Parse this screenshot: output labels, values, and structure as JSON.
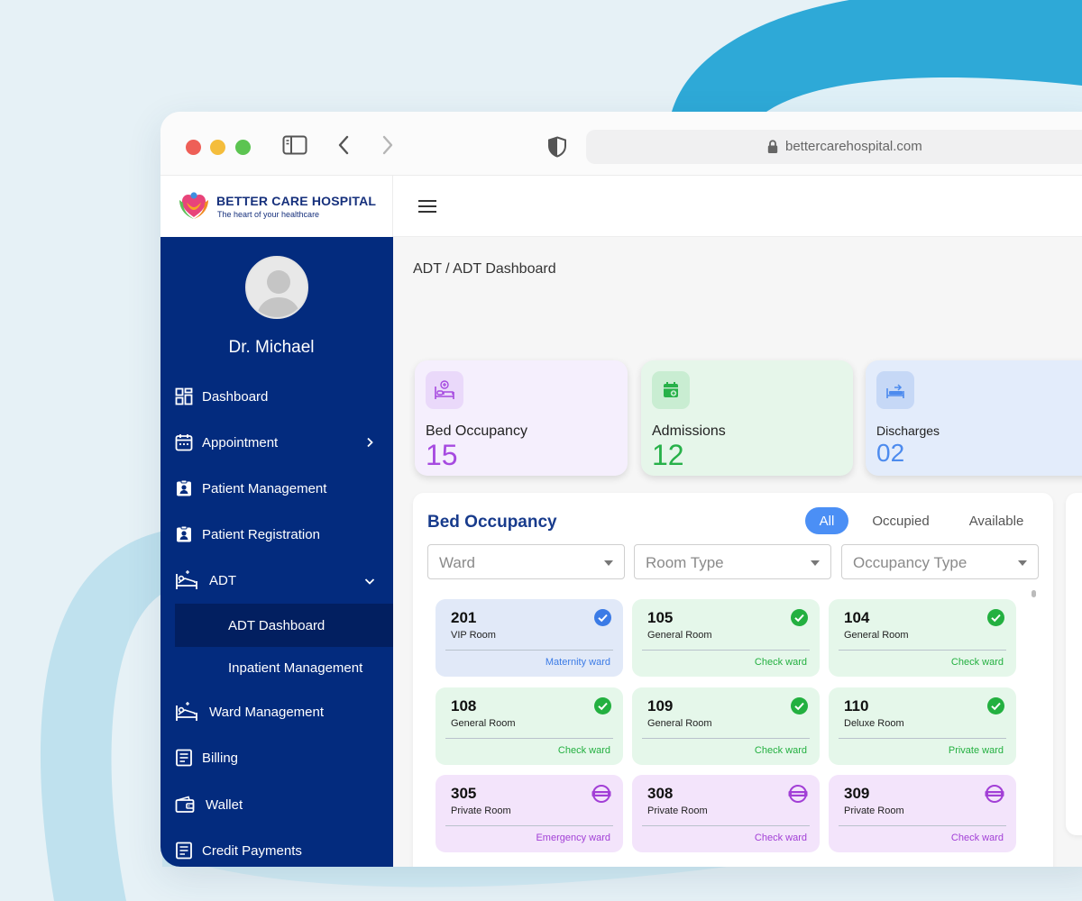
{
  "browser": {
    "url": "bettercarehospital.com"
  },
  "brand": {
    "name": "BETTER CARE HOSPITAL",
    "tagline": "The heart of your healthcare"
  },
  "user": {
    "name": "Dr. Michael"
  },
  "sidebar": {
    "items": [
      {
        "label": "Dashboard",
        "icon": "dashboard-icon"
      },
      {
        "label": "Appointment",
        "icon": "calendar-icon"
      },
      {
        "label": "Patient Management",
        "icon": "id-badge-icon"
      },
      {
        "label": "Patient Registration",
        "icon": "id-badge-icon"
      },
      {
        "label": "ADT",
        "icon": "bed-icon"
      },
      {
        "label": "ADT Dashboard"
      },
      {
        "label": "Inpatient Management"
      },
      {
        "label": "Ward Management",
        "icon": "bed-icon"
      },
      {
        "label": "Billing",
        "icon": "receipt-icon"
      },
      {
        "label": "Wallet",
        "icon": "wallet-icon"
      },
      {
        "label": "Credit Payments",
        "icon": "receipt-icon"
      }
    ]
  },
  "breadcrumb": "ADT / ADT Dashboard",
  "stats": [
    {
      "label": "Bed Occupancy",
      "value": "15",
      "color": "#a64ae0",
      "bg": "#f5effd"
    },
    {
      "label": "Admissions",
      "value": "12",
      "color": "#27b149",
      "bg": "#e6f6ea"
    },
    {
      "label": "Discharges",
      "value": "02",
      "color": "#4d8bee",
      "bg": "#e3ecfb"
    }
  ],
  "occupancy": {
    "title": "Bed Occupancy",
    "filters": [
      "All",
      "Occupied",
      "Available"
    ],
    "active_filter": "All",
    "selects": [
      "Ward",
      "Room Type",
      "Occupancy Type"
    ],
    "rooms": [
      {
        "number": "201",
        "type": "VIP Room",
        "ward": "Maternity ward",
        "status": "selected"
      },
      {
        "number": "105",
        "type": "General Room",
        "ward": "Check ward",
        "status": "available"
      },
      {
        "number": "104",
        "type": "General Room",
        "ward": "Check ward",
        "status": "available"
      },
      {
        "number": "108",
        "type": "General Room",
        "ward": "Check ward",
        "status": "available"
      },
      {
        "number": "109",
        "type": "General Room",
        "ward": "Check ward",
        "status": "available"
      },
      {
        "number": "110",
        "type": "Deluxe Room",
        "ward": "Private ward",
        "status": "available"
      },
      {
        "number": "305",
        "type": "Private Room",
        "ward": "Emergency ward",
        "status": "occupied"
      },
      {
        "number": "308",
        "type": "Private Room",
        "ward": "Check ward",
        "status": "occupied"
      },
      {
        "number": "309",
        "type": "Private Room",
        "ward": "Check ward",
        "status": "occupied"
      }
    ]
  },
  "colors": {
    "sidebar": "#032b7e",
    "sidebar_active": "#021f60",
    "accent_blue": "#4b8ff5",
    "available_bg": "#e5f7ea",
    "available_fg": "#23b040",
    "occupied_bg": "#f3e4fb",
    "occupied_fg": "#a23fd6",
    "selected_bg": "#e1e9f8",
    "selected_fg": "#3b7be6"
  }
}
